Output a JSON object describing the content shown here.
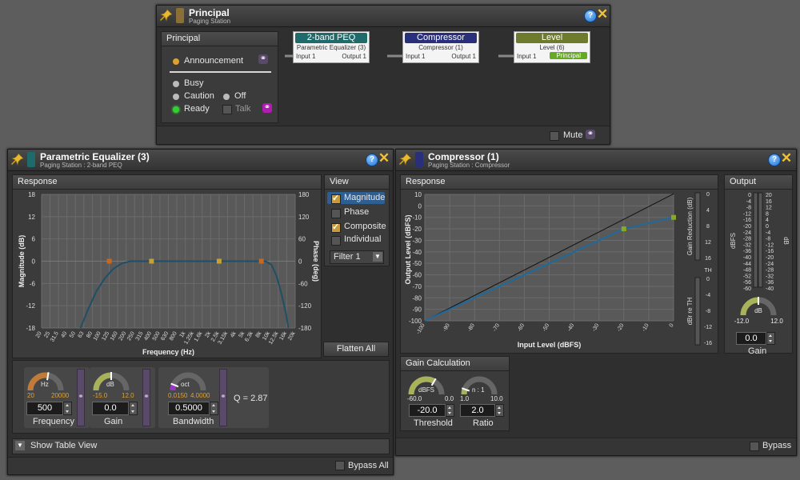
{
  "colors": {
    "eq": "#1f6b6b",
    "compressor": "#2a2f7c",
    "level": "#6f7b2c",
    "principal": "#8a7038",
    "accent_knob": "#a8b25a",
    "curve": "#1f4f66",
    "node": "#c7a030",
    "node_green": "#88aa22",
    "led_ready": "#2fd12f",
    "led_announce": "#e0a030"
  },
  "paging": {
    "title": "Principal",
    "subtitle": "Paging Station",
    "principal_panel": {
      "title": "Principal",
      "announcement": "Announcement",
      "busy": "Busy",
      "caution": "Caution",
      "off": "Off",
      "ready": "Ready",
      "talk": "Talk"
    },
    "blocks": [
      {
        "title": "2-band PEQ",
        "sub": "Parametric Equalizer (3)",
        "in": "Input 1",
        "out": "Output 1"
      },
      {
        "title": "Compressor",
        "sub": "Compressor (1)",
        "in": "Input 1",
        "out": "Output 1"
      },
      {
        "title": "Level",
        "sub": "Level (6)",
        "in": "Input 1",
        "out": "Principal"
      }
    ],
    "mute": "Mute"
  },
  "peq": {
    "title": "Parametric Equalizer (3)",
    "subtitle": "Paging Station : 2-band PEQ",
    "response": "Response",
    "view": "View",
    "view_items": {
      "magnitude": "Magnitude",
      "phase": "Phase",
      "composite": "Composite",
      "individual": "Individual"
    },
    "filter": "Filter 1",
    "flatten": "Flatten All",
    "frequency": {
      "unit": "Hz",
      "min": "20",
      "max": "20000",
      "value": "500",
      "label": "Frequency"
    },
    "gain": {
      "unit": "dB",
      "min": "-15.0",
      "max": "12.0",
      "value": "0.0",
      "label": "Gain"
    },
    "bandwidth": {
      "unit": "oct",
      "min": "0.0150",
      "max": "4.0000",
      "value": "0.5000",
      "label": "Bandwidth"
    },
    "q": "Q = 2.87",
    "table_view": "Show Table View",
    "bypass_all": "Bypass All",
    "chart": {
      "left_ticks": [
        "18",
        "12",
        "6",
        "0",
        "-6",
        "-12",
        "-18"
      ],
      "right_ticks": [
        "180",
        "120",
        "60",
        "0",
        "-60",
        "-120",
        "-180"
      ],
      "x_ticks": [
        "20",
        "25",
        "31.5",
        "40",
        "50",
        "63",
        "80",
        "100",
        "125",
        "160",
        "200",
        "250",
        "315",
        "400",
        "500",
        "630",
        "800",
        "1k",
        "1.25k",
        "1.6k",
        "2k",
        "2.5k",
        "3.15k",
        "4k",
        "5k",
        "6.3k",
        "8k",
        "10k",
        "12.5k",
        "16k",
        "20k"
      ],
      "xlabel": "Frequency (Hz)",
      "ylabel": "Magnitude (dB)",
      "y2label": "Phase (deg)"
    }
  },
  "comp": {
    "title": "Compressor (1)",
    "subtitle": "Paging Station : Compressor",
    "response": "Response",
    "output": "Output",
    "chart": {
      "x_ticks": [
        "-100",
        "-90",
        "-80",
        "-70",
        "-60",
        "-50",
        "-40",
        "-30",
        "-20",
        "-10",
        "0"
      ],
      "y_ticks": [
        "10",
        "0",
        "-10",
        "-20",
        "-30",
        "-40",
        "-50",
        "-60",
        "-70",
        "-80",
        "-90",
        "-100"
      ],
      "xlabel": "Input Level (dBFS)",
      "ylabel": "Output Level (dBFS)"
    },
    "gr_ticks": [
      "0",
      "4",
      "8",
      "12",
      "16"
    ],
    "gr_label": "Gain Reduction (dB)",
    "th": "TH",
    "rt_ticks": [
      "0",
      "-4",
      "-8",
      "-12",
      "-16"
    ],
    "rt_label": "dBr re TH",
    "out_ticks_left": [
      "0",
      "-4",
      "-8",
      "-12",
      "-16",
      "-20",
      "-24",
      "-28",
      "-32",
      "-36",
      "-40",
      "-44",
      "-48",
      "-52",
      "-56",
      "-60"
    ],
    "out_ticks_right": [
      "20",
      "16",
      "12",
      "8",
      "4",
      "0",
      "-4",
      "-8",
      "-12",
      "-16",
      "-20",
      "-24",
      "-28",
      "-32",
      "-36",
      "-40"
    ],
    "dbfs": "dBFS",
    "db": "dB",
    "out_knob": {
      "unit": "dB",
      "min": "-12.0",
      "max": "12.0",
      "value": "0.0",
      "label": "Gain"
    },
    "gain_calc": "Gain Calculation",
    "threshold": {
      "unit": "dBFS",
      "min": "-60.0",
      "max": "0.0",
      "value": "-20.0",
      "label": "Threshold"
    },
    "ratio": {
      "unit": "n : 1",
      "min": "1.0",
      "max": "10.0",
      "value": "2.0",
      "label": "Ratio"
    },
    "bypass": "Bypass"
  }
}
